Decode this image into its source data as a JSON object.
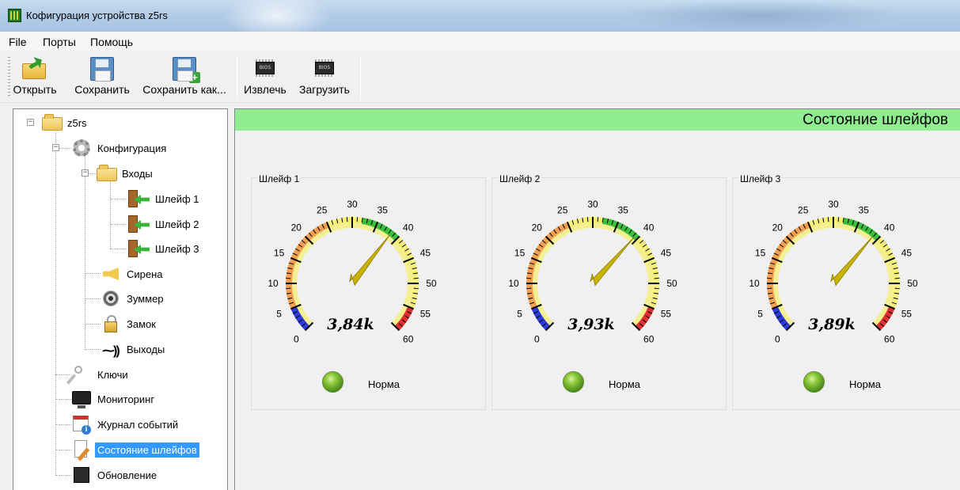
{
  "window": {
    "title": "Кофигурация устройства z5rs"
  },
  "menu": [
    "File",
    "Порты",
    "Помощь"
  ],
  "toolbar": {
    "open": "Открыть",
    "save": "Сохранить",
    "save_as": "Сохранить как...",
    "extract": "Извлечь",
    "load": "Загрузить",
    "bios_chip_text": "BIOS"
  },
  "tree": {
    "root": "z5rs",
    "config": "Конфигурация",
    "inputs": "Входы",
    "loop1": "Шлейф 1",
    "loop2": "Шлейф 2",
    "loop3": "Шлейф 3",
    "siren": "Сирена",
    "buzzer": "Зуммер",
    "lock": "Замок",
    "outputs": "Выходы",
    "keys": "Ключи",
    "monitoring": "Мониторинг",
    "event_log": "Журнал событий",
    "loop_status": "Состояние шлейфов",
    "update": "Обновление"
  },
  "panel": {
    "title": "Состояние шлейфов",
    "gauges": [
      {
        "label": "Шлейф 1",
        "value_text": "3,84k",
        "needle": 38.4,
        "status": "Норма"
      },
      {
        "label": "Шлейф 2",
        "value_text": "3,93k",
        "needle": 39.3,
        "status": "Норма"
      },
      {
        "label": "Шлейф 3",
        "value_text": "3,89k",
        "needle": 38.9,
        "status": "Норма"
      }
    ],
    "scale": {
      "min": 0,
      "max": 60,
      "major_step": 5,
      "ticks": [
        "0",
        "5",
        "10",
        "15",
        "20",
        "25",
        "30",
        "35",
        "40",
        "45",
        "50",
        "55",
        "60"
      ]
    },
    "zone_colors": {
      "blue": "#2e3bd6",
      "orange": "#f0a050",
      "yellow": "#f5f07a",
      "green": "#3cbf3c",
      "red": "#e03030",
      "needle": "#c8b400"
    }
  }
}
